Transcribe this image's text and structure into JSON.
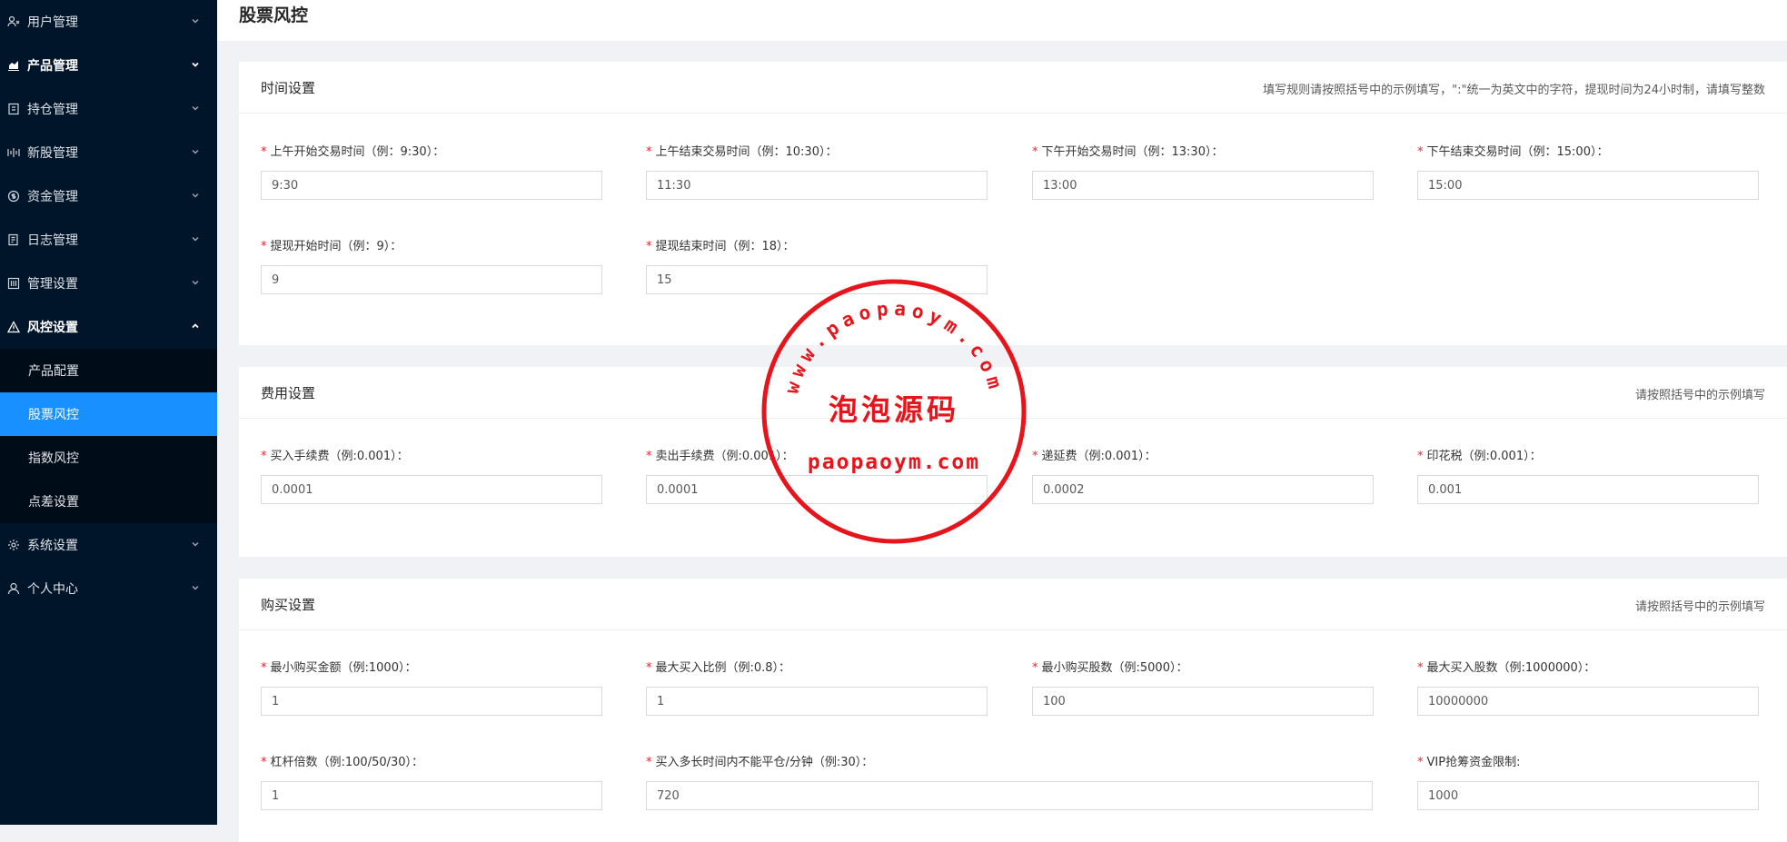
{
  "sidebar": {
    "items": [
      {
        "label": "用户管理",
        "icon": "user-admin-icon",
        "expanded": false
      },
      {
        "label": "产品管理",
        "icon": "chart-icon",
        "expanded": false
      },
      {
        "label": "持仓管理",
        "icon": "position-icon",
        "expanded": false
      },
      {
        "label": "新股管理",
        "icon": "ipo-icon",
        "expanded": false
      },
      {
        "label": "资金管理",
        "icon": "money-icon",
        "expanded": false
      },
      {
        "label": "日志管理",
        "icon": "log-icon",
        "expanded": false
      },
      {
        "label": "管理设置",
        "icon": "settings-panel-icon",
        "expanded": false
      },
      {
        "label": "风控设置",
        "icon": "warning-icon",
        "expanded": true
      },
      {
        "label": "系统设置",
        "icon": "gear-icon",
        "expanded": false
      },
      {
        "label": "个人中心",
        "icon": "person-icon",
        "expanded": false
      }
    ],
    "submenu": [
      {
        "label": "产品配置",
        "active": false
      },
      {
        "label": "股票风控",
        "active": true
      },
      {
        "label": "指数风控",
        "active": false
      },
      {
        "label": "点差设置",
        "active": false
      }
    ]
  },
  "page": {
    "title": "股票风控"
  },
  "sections": {
    "time": {
      "title": "时间设置",
      "hint": "填写规则请按照括号中的示例填写，\":\"统一为英文中的字符，提现时间为24小时制，请填写整数",
      "fields": [
        {
          "label": "上午开始交易时间（例：9:30）：",
          "value": "9:30"
        },
        {
          "label": "上午结束交易时间（例：10:30）：",
          "value": "11:30"
        },
        {
          "label": "下午开始交易时间（例：13:30）：",
          "value": "13:00"
        },
        {
          "label": "下午结束交易时间（例：15:00）：",
          "value": "15:00"
        },
        {
          "label": "提现开始时间（例：9）：",
          "value": "9"
        },
        {
          "label": "提现结束时间（例：18）：",
          "value": "15"
        }
      ]
    },
    "fee": {
      "title": "费用设置",
      "hint": "请按照括号中的示例填写",
      "fields": [
        {
          "label": "买入手续费（例:0.001）：",
          "value": "0.0001"
        },
        {
          "label": "卖出手续费（例:0.001）：",
          "value": "0.0001"
        },
        {
          "label": "递延费（例:0.001）：",
          "value": "0.0002"
        },
        {
          "label": "印花税（例:0.001）：",
          "value": "0.001"
        }
      ]
    },
    "buy": {
      "title": "购买设置",
      "hint": "请按照括号中的示例填写",
      "fields": [
        {
          "label": "最小购买金额（例:1000）：",
          "value": "1"
        },
        {
          "label": "最大买入比例（例:0.8）：",
          "value": "1"
        },
        {
          "label": "最小购买股数（例:5000）：",
          "value": "100"
        },
        {
          "label": "最大买入股数（例:1000000）：",
          "value": "10000000"
        },
        {
          "label": "杠杆倍数（例:100/50/30）：",
          "value": "1"
        },
        {
          "label": "买入多长时间内不能平仓/分钟（例:30）：",
          "value": "720"
        },
        {
          "label": "VIP抢筹资金限制:",
          "value": "1000"
        }
      ]
    }
  },
  "watermark": {
    "arc_text": "www.paopaoym.com",
    "center_text": "泡泡源码",
    "bottom_text": "paopaoym.com",
    "color": "#e8141b"
  },
  "colors": {
    "sidebar_bg": "#001529",
    "submenu_bg": "#000c17",
    "accent": "#1890ff",
    "required": "#f5222d"
  }
}
